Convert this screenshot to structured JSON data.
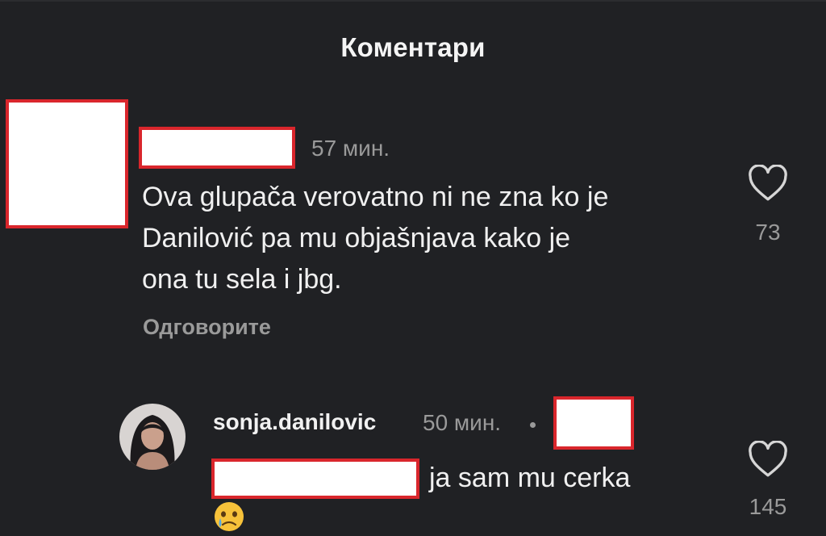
{
  "header": {
    "title": "Коментари"
  },
  "comment_1": {
    "time": "57 мин.",
    "text_lines": [
      "Ova glupača verovatno ni ne zna ko je",
      "Danilović pa mu objašnjava kako je",
      "ona tu sela i jbg."
    ],
    "reply_label": "Одговорите",
    "likes": "73"
  },
  "comment_2": {
    "username": "sonja.danilovic",
    "time": "50 мин.",
    "text": "ja sam mu cerka",
    "likes": "145"
  },
  "icons": {
    "like": "heart-outline-icon",
    "emoji": "face-holding-back-tears-emoji"
  },
  "colors": {
    "background": "#202124",
    "redaction_border": "#d9262c",
    "muted_text": "#9a9a9a"
  }
}
